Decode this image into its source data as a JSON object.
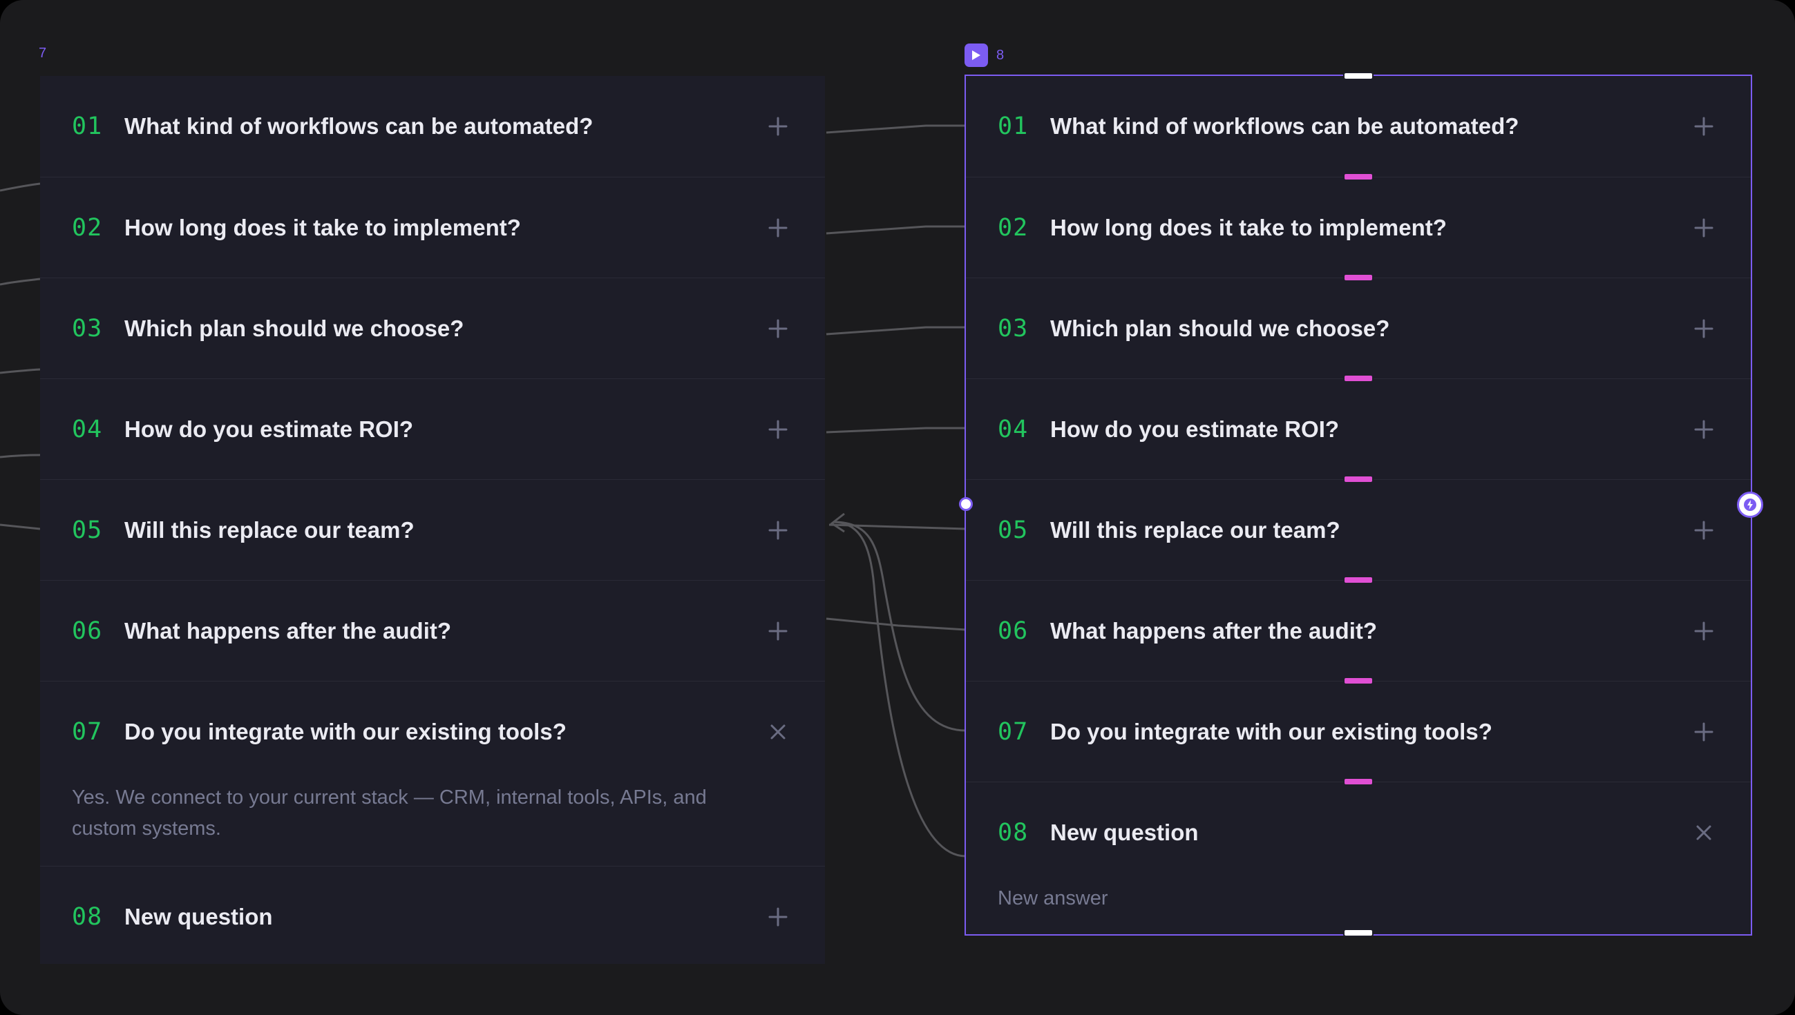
{
  "left_frame": {
    "label": "7",
    "items": [
      {
        "num": "01",
        "question": "What kind of workflows can be automated?",
        "expanded": false,
        "answer": ""
      },
      {
        "num": "02",
        "question": "How long does it take to implement?",
        "expanded": false,
        "answer": ""
      },
      {
        "num": "03",
        "question": "Which plan should we choose?",
        "expanded": false,
        "answer": ""
      },
      {
        "num": "04",
        "question": "How do you estimate ROI?",
        "expanded": false,
        "answer": ""
      },
      {
        "num": "05",
        "question": "Will this replace our team?",
        "expanded": false,
        "answer": ""
      },
      {
        "num": "06",
        "question": "What happens after the audit?",
        "expanded": false,
        "answer": ""
      },
      {
        "num": "07",
        "question": "Do you integrate with our existing tools?",
        "expanded": true,
        "answer": "Yes. We connect to your current stack — CRM, internal tools, APIs, and custom systems."
      },
      {
        "num": "08",
        "question": "New question",
        "expanded": false,
        "answer": ""
      }
    ]
  },
  "right_frame": {
    "label": "8",
    "badge_icon": "play-icon",
    "selected": true,
    "items": [
      {
        "num": "01",
        "question": "What kind of workflows can be automated?",
        "expanded": false,
        "answer": ""
      },
      {
        "num": "02",
        "question": "How long does it take to implement?",
        "expanded": false,
        "answer": ""
      },
      {
        "num": "03",
        "question": "Which plan should we choose?",
        "expanded": false,
        "answer": ""
      },
      {
        "num": "04",
        "question": "How do you estimate ROI?",
        "expanded": false,
        "answer": ""
      },
      {
        "num": "05",
        "question": "Will this replace our team?",
        "expanded": false,
        "answer": ""
      },
      {
        "num": "06",
        "question": "What happens after the audit?",
        "expanded": false,
        "answer": ""
      },
      {
        "num": "07",
        "question": "Do you integrate with our existing tools?",
        "expanded": false,
        "answer": ""
      },
      {
        "num": "08",
        "question": "New question",
        "expanded": true,
        "answer": "New answer"
      }
    ]
  },
  "icons": {
    "expand": "plus-icon",
    "collapse": "close-icon",
    "interaction": "lightning-icon"
  },
  "colors": {
    "canvas": "#1b1b1d",
    "panel": "#1d1d28",
    "accent": "#7c5cf2",
    "number": "#22c55e",
    "question": "#ebebf2",
    "answer": "#777a92",
    "handle": "#e04fd4",
    "wire": "#5a5a5e"
  }
}
